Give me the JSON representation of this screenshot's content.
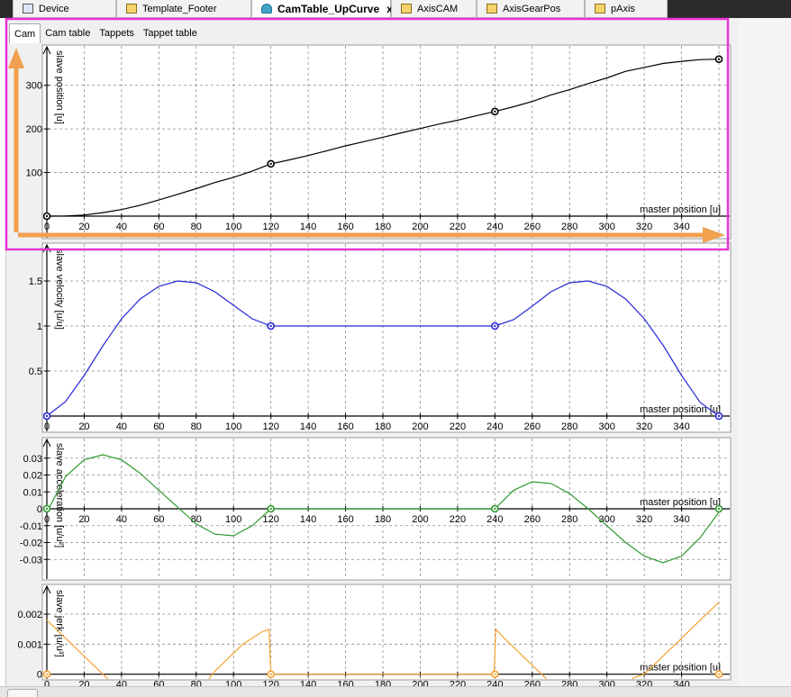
{
  "document_tabs": [
    {
      "label": "Device",
      "icon": "device-icon"
    },
    {
      "label": "Template_Footer",
      "icon": "template-icon"
    },
    {
      "label": "CamTable_UpCurve",
      "icon": "cam-icon",
      "active": true,
      "close": "x"
    },
    {
      "label": "AxisCAM",
      "icon": "axis-icon"
    },
    {
      "label": "AxisGearPos",
      "icon": "axis-icon"
    },
    {
      "label": "pAxis",
      "icon": "axis-icon"
    }
  ],
  "editor_tabs": [
    {
      "label": "Cam",
      "active": true
    },
    {
      "label": "Cam table"
    },
    {
      "label": "Tappets"
    },
    {
      "label": "Tappet table"
    }
  ],
  "x_ticks": [
    "0",
    "20",
    "40",
    "60",
    "80",
    "100",
    "120",
    "140",
    "160",
    "180",
    "200",
    "220",
    "240",
    "260",
    "280",
    "300",
    "320",
    "340"
  ],
  "chart_data": [
    {
      "type": "line",
      "xlabel": "master position [u]",
      "ylabel": "slave position [u]",
      "xlim": [
        0,
        360
      ],
      "ylim": [
        0,
        380
      ],
      "ytick_values": [
        100,
        200,
        300
      ],
      "ytick_labels": [
        "100",
        "200",
        "300"
      ],
      "color": "#000000",
      "x": [
        0,
        10,
        20,
        30,
        40,
        50,
        60,
        70,
        80,
        90,
        100,
        110,
        120,
        130,
        140,
        150,
        160,
        170,
        180,
        190,
        200,
        210,
        220,
        230,
        240,
        250,
        260,
        270,
        280,
        290,
        300,
        310,
        320,
        330,
        340,
        350,
        360
      ],
      "values": [
        0,
        0.5,
        2.5,
        8,
        15,
        25,
        37,
        50,
        63,
        77,
        89,
        103,
        120,
        129,
        139,
        150,
        161,
        171,
        181,
        191,
        201,
        211,
        220,
        230,
        240,
        251,
        263,
        278,
        290,
        304,
        317,
        332,
        341,
        350,
        355,
        359,
        360
      ],
      "points": [
        [
          0,
          0
        ],
        [
          120,
          120
        ],
        [
          240,
          240
        ],
        [
          360,
          360
        ]
      ]
    },
    {
      "type": "line",
      "xlabel": "master position [u]",
      "ylabel": "slave velocity [u/u]",
      "xlim": [
        0,
        360
      ],
      "ylim": [
        0,
        1.9
      ],
      "ytick_values": [
        0.5,
        1,
        1.5
      ],
      "ytick_labels": [
        "0.5",
        "1",
        "1.5"
      ],
      "color": "#2626d9",
      "x": [
        0,
        10,
        20,
        30,
        40,
        50,
        60,
        70,
        80,
        90,
        100,
        110,
        120,
        130,
        140,
        150,
        160,
        170,
        180,
        190,
        200,
        210,
        220,
        230,
        240,
        250,
        260,
        270,
        280,
        290,
        300,
        310,
        320,
        330,
        340,
        350,
        360
      ],
      "values": [
        0,
        0.16,
        0.45,
        0.78,
        1.08,
        1.3,
        1.44,
        1.5,
        1.48,
        1.38,
        1.23,
        1.08,
        1.0,
        1.0,
        1.0,
        1.0,
        1.0,
        1.0,
        1.0,
        1.0,
        1.0,
        1.0,
        1.0,
        1.0,
        1.0,
        1.07,
        1.22,
        1.38,
        1.48,
        1.5,
        1.44,
        1.3,
        1.08,
        0.79,
        0.45,
        0.15,
        0
      ],
      "points": [
        [
          0,
          0
        ],
        [
          120,
          1
        ],
        [
          240,
          1
        ],
        [
          360,
          0
        ]
      ]
    },
    {
      "type": "line",
      "xlabel": "master position [u]",
      "ylabel": "slave acceleration [u/u²]",
      "xlim": [
        0,
        360
      ],
      "ylim": [
        -0.04,
        0.04
      ],
      "ytick_values": [
        -0.03,
        -0.02,
        -0.01,
        0,
        0.01,
        0.02,
        0.03
      ],
      "ytick_labels": [
        "-0.03",
        "-0.02",
        "-0.01",
        "0",
        "0.01",
        "0.02",
        "0.03"
      ],
      "color": "#2e9a2e",
      "x": [
        0,
        10,
        20,
        30,
        40,
        50,
        60,
        70,
        80,
        90,
        100,
        110,
        120,
        130,
        140,
        150,
        160,
        170,
        180,
        190,
        200,
        210,
        220,
        230,
        240,
        250,
        260,
        270,
        280,
        290,
        300,
        310,
        320,
        330,
        340,
        350,
        360
      ],
      "values": [
        -0.002,
        0.019,
        0.029,
        0.032,
        0.029,
        0.021,
        0.011,
        0.001,
        -0.009,
        -0.015,
        -0.016,
        -0.01,
        0,
        0,
        0,
        0,
        0,
        0,
        0,
        0,
        0,
        0,
        0,
        0,
        0,
        0.011,
        0.016,
        0.015,
        0.009,
        0,
        -0.01,
        -0.02,
        -0.028,
        -0.032,
        -0.028,
        -0.017,
        -0.002
      ],
      "points": [
        [
          0,
          0
        ],
        [
          120,
          0
        ],
        [
          240,
          0
        ],
        [
          360,
          0
        ]
      ]
    },
    {
      "type": "line",
      "xlabel": "master position [u]",
      "ylabel": "slave jerk [u/u³]",
      "xlim": [
        0,
        360
      ],
      "ylim": [
        -0.0001,
        0.0029
      ],
      "ytick_values": [
        0,
        0.001,
        0.002
      ],
      "ytick_labels": [
        "0",
        "0.001",
        "0.002"
      ],
      "color": "#f4a431",
      "x": [
        0,
        5,
        10,
        15,
        20,
        25,
        30,
        35,
        40,
        50,
        80,
        85,
        90,
        95,
        100,
        105,
        110,
        115,
        119,
        119.5,
        120,
        120.5,
        130,
        200,
        239,
        239.5,
        240,
        240.5,
        245,
        250,
        255,
        260,
        265,
        270,
        310,
        315,
        320,
        325,
        330,
        335,
        340,
        345,
        350,
        355,
        360
      ],
      "values": [
        0.0018,
        0.0015,
        0.0012,
        0.0009,
        0.0006,
        0.0003,
        0,
        -0.0003,
        -0.0006,
        -0.0012,
        -0.0015,
        -0.0003,
        0.0001,
        0.0004,
        0.0007,
        0.001,
        0.0012,
        0.0014,
        0.0015,
        0.0007,
        0,
        0,
        0,
        0,
        0,
        0,
        0.0007,
        0.0015,
        0.0012,
        0.0009,
        0.0006,
        0.0003,
        0,
        -0.0003,
        -0.0003,
        -0.0001,
        0,
        0.0003,
        0.0006,
        0.0009,
        0.0012,
        0.0015,
        0.0018,
        0.0021,
        0.0024
      ],
      "points": [
        [
          0,
          0
        ],
        [
          120,
          0
        ],
        [
          240,
          0
        ],
        [
          360,
          0
        ]
      ]
    }
  ],
  "overlays": {
    "highlight_color": "#e535d3",
    "arrow_color": "#f0a04e"
  }
}
